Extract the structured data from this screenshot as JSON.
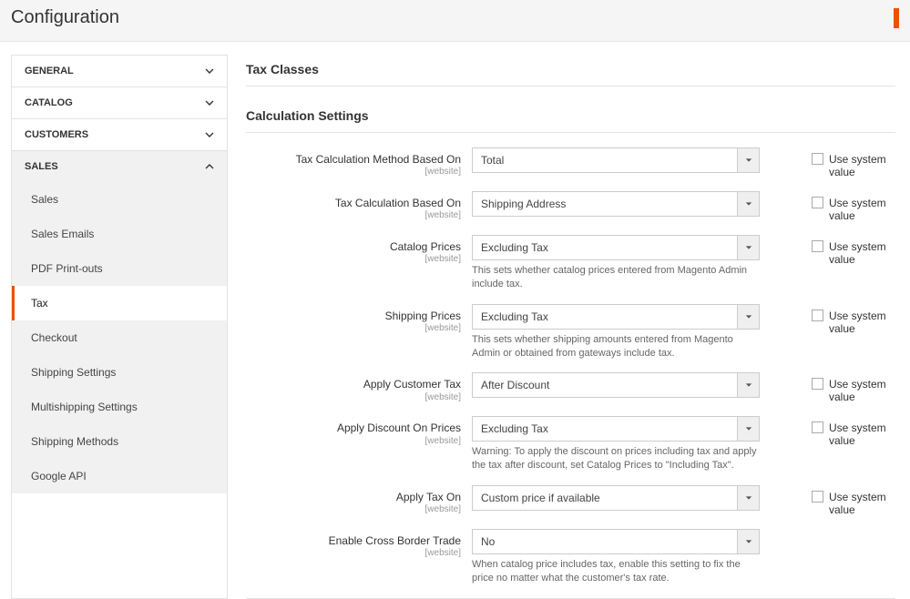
{
  "header": {
    "title": "Configuration"
  },
  "sidebar": {
    "groups": [
      {
        "label": "GENERAL",
        "open": false
      },
      {
        "label": "CATALOG",
        "open": false
      },
      {
        "label": "CUSTOMERS",
        "open": false
      },
      {
        "label": "SALES",
        "open": true,
        "items": [
          {
            "label": "Sales",
            "active": false
          },
          {
            "label": "Sales Emails",
            "active": false
          },
          {
            "label": "PDF Print-outs",
            "active": false
          },
          {
            "label": "Tax",
            "active": true
          },
          {
            "label": "Checkout",
            "active": false
          },
          {
            "label": "Shipping Settings",
            "active": false
          },
          {
            "label": "Multishipping Settings",
            "active": false
          },
          {
            "label": "Shipping Methods",
            "active": false
          },
          {
            "label": "Google API",
            "active": false
          }
        ]
      }
    ]
  },
  "sections": {
    "tax_classes": {
      "title": "Tax Classes"
    },
    "calc_settings": {
      "title": "Calculation Settings",
      "scope_text": "[website]",
      "system_label": "Use system value",
      "fields": {
        "method": {
          "label": "Tax Calculation Method Based On",
          "value": "Total",
          "has_system": true
        },
        "based_on": {
          "label": "Tax Calculation Based On",
          "value": "Shipping Address",
          "has_system": true
        },
        "catalog_prices": {
          "label": "Catalog Prices",
          "value": "Excluding Tax",
          "note": "This sets whether catalog prices entered from Magento Admin include tax.",
          "has_system": true
        },
        "shipping_prices": {
          "label": "Shipping Prices",
          "value": "Excluding Tax",
          "note": "This sets whether shipping amounts entered from Magento Admin or obtained from gateways include tax.",
          "has_system": true
        },
        "customer_tax": {
          "label": "Apply Customer Tax",
          "value": "After Discount",
          "has_system": true
        },
        "discount_on_prices": {
          "label": "Apply Discount On Prices",
          "value": "Excluding Tax",
          "note": "Warning: To apply the discount on prices including tax and apply the tax after discount, set Catalog Prices to \"Including Tax\".",
          "has_system": true
        },
        "apply_tax_on": {
          "label": "Apply Tax On",
          "value": "Custom price if available",
          "has_system": true
        },
        "cross_border": {
          "label": "Enable Cross Border Trade",
          "value": "No",
          "note": "When catalog price includes tax, enable this setting to fix the price no matter what the customer's tax rate.",
          "has_system": false
        }
      }
    }
  }
}
